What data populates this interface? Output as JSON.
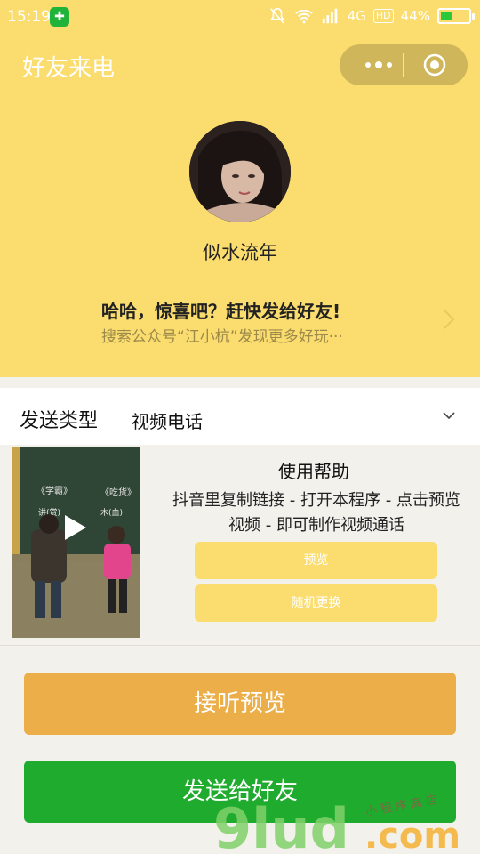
{
  "status_bar": {
    "time": "15:19",
    "network": "4G",
    "hd_label": "HD",
    "battery_percent": "44%",
    "battery_level": 0.44
  },
  "header": {
    "title": "好友来电",
    "capsule_more_icon": "more-dots-icon",
    "capsule_close_icon": "target-close-icon"
  },
  "profile": {
    "nickname": "似水流年"
  },
  "promo": {
    "main_text": "哈哈，惊喜吧？赶快发给好友!",
    "sub_text": "搜索公众号“江小杭”发现更多好玩···"
  },
  "send_type": {
    "label": "发送类型",
    "value": "视频电话"
  },
  "help": {
    "title": "使用帮助",
    "text": "抖音里复制链接 - 打开本程序 - 点击预览视频 - 即可制作视频通话",
    "preview_button": "预览",
    "random_button": "随机更换"
  },
  "actions": {
    "answer_preview": "接听预览",
    "send_to_friend": "发送给好友"
  },
  "colors": {
    "header_bg": "#fbdc6e",
    "answer_btn": "#ebae48",
    "send_btn": "#1eab2e"
  }
}
